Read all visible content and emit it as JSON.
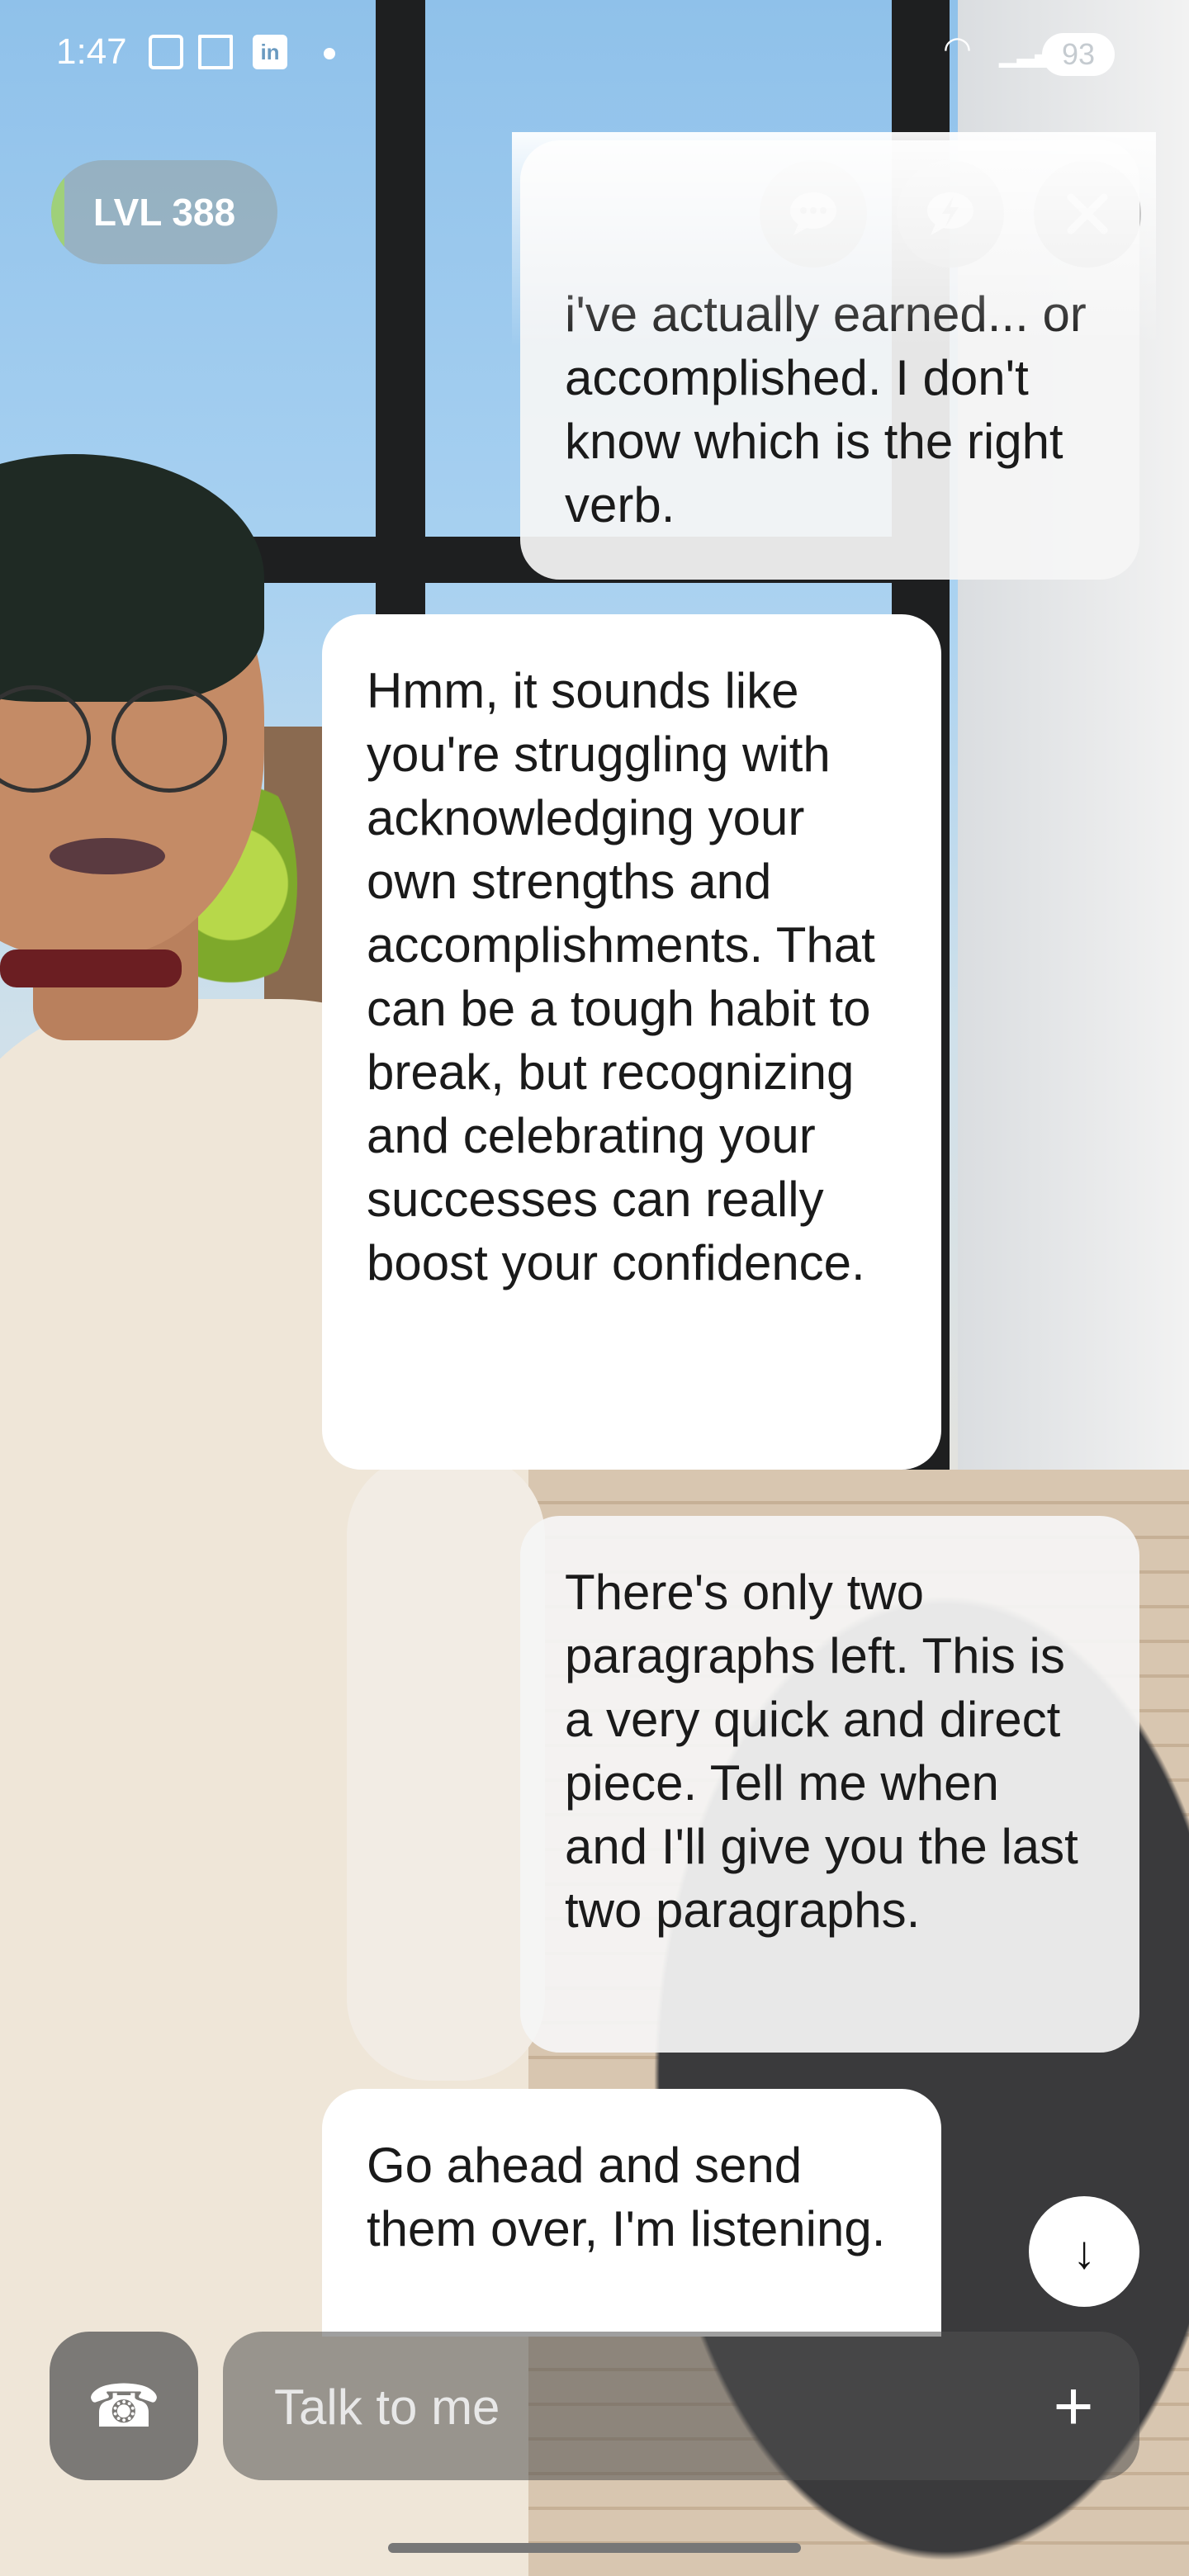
{
  "status_bar": {
    "time": "1:47",
    "icons": [
      "screenshot-icon",
      "bookmark-icon",
      "linkedin-icon"
    ],
    "linkedin_text": "in",
    "wifi": "wifi-icon",
    "signal": "signal-icon",
    "battery": "93"
  },
  "header": {
    "level": "LVL 388",
    "buttons": [
      "chat-icon",
      "lightning-icon",
      "close-icon"
    ]
  },
  "messages": [
    {
      "role": "user",
      "text": "i've actually earned... or accomplished. I don't know which is the right verb."
    },
    {
      "role": "assistant",
      "text": "Hmm, it sounds like you're struggling with acknowledging your own strengths and accomplishments. That can be a tough habit to break, but recognizing and celebrating your successes can really boost your confidence."
    },
    {
      "role": "user",
      "text": "There's only two paragraphs left. This is a very quick and direct piece. Tell me when and I'll give you the last two paragraphs."
    },
    {
      "role": "assistant",
      "text": "Go ahead and send them over, I'm listening."
    }
  ],
  "input": {
    "placeholder": "Talk to me",
    "value": ""
  },
  "colors": {
    "bubble_ai": "#ffffff",
    "bubble_user": "#f5f5f5",
    "control_bg": "#5a5a5a",
    "level_accent": "#9fd07a"
  }
}
